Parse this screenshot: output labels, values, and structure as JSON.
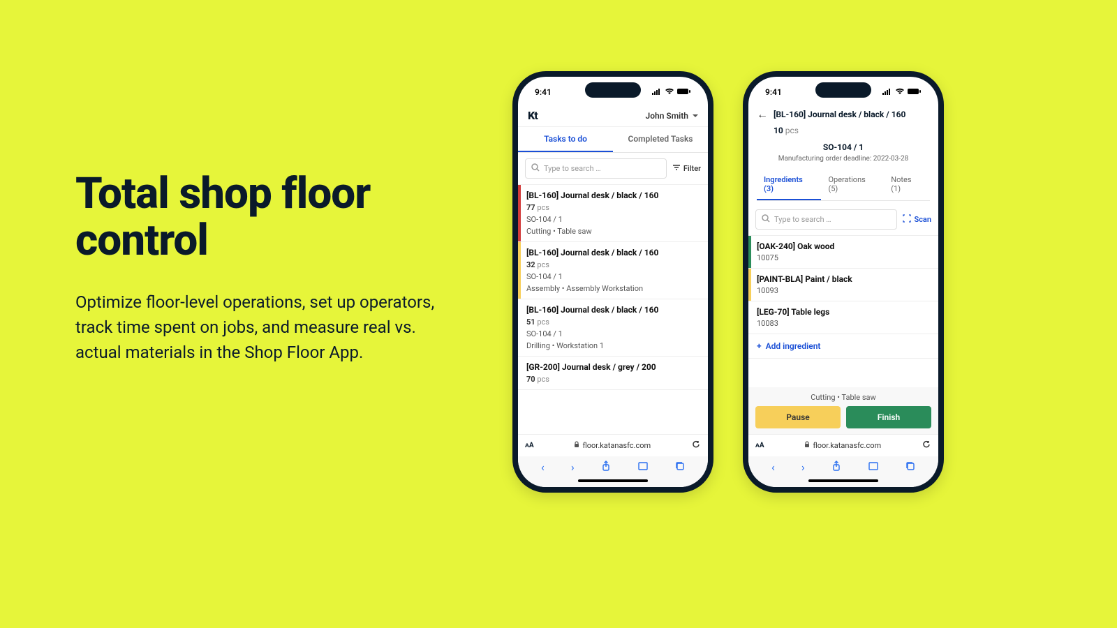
{
  "hero": {
    "title": "Total shop floor control",
    "body": "Optimize floor-level operations, set up operators, track time spent on jobs, and measure real vs. actual materials in the Shop Floor App."
  },
  "status_time": "9:41",
  "browser_url": "floor.katanasfc.com",
  "phone1": {
    "logo": "Kt",
    "user": "John Smith",
    "tabs": {
      "todo": "Tasks to do",
      "completed": "Completed Tasks"
    },
    "search_placeholder": "Type to search …",
    "filter_label": "Filter",
    "tasks": [
      {
        "title": "[BL-160] Journal desk / black / 160",
        "qty": "77",
        "unit": "pcs",
        "so": "SO-104 / 1",
        "op": "Cutting  •  Table saw",
        "stripe": "#d23c3c"
      },
      {
        "title": "[BL-160] Journal desk / black / 160",
        "qty": "32",
        "unit": "pcs",
        "so": "SO-104 / 1",
        "op": "Assembly  •  Assembly Workstation",
        "stripe": "#f7cf5a"
      },
      {
        "title": "[BL-160] Journal desk / black / 160",
        "qty": "51",
        "unit": "pcs",
        "so": "SO-104 / 1",
        "op": "Drilling  •  Workstation 1",
        "stripe": "#ffffff"
      },
      {
        "title": "[GR-200] Journal desk / grey / 200",
        "qty": "70",
        "unit": "pcs",
        "so": "",
        "op": "",
        "stripe": "#ffffff"
      }
    ]
  },
  "phone2": {
    "title": "[BL-160] Journal desk / black / 160",
    "qty": "10",
    "unit": "pcs",
    "so": "SO-104 / 1",
    "deadline": "Manufacturing order deadline: 2022-03-28",
    "subtabs": {
      "ingredients": "Ingredients (3)",
      "operations": "Operations (5)",
      "notes": "Notes (1)"
    },
    "search_placeholder": "Type to search …",
    "scan_label": "Scan",
    "ingredients": [
      {
        "name": "[OAK-240] Oak wood",
        "code": "10075",
        "stripe": "#2a8c5a"
      },
      {
        "name": "[PAINT-BLA] Paint / black",
        "code": "10093",
        "stripe": "#f7cf5a"
      },
      {
        "name": "[LEG-70] Table legs",
        "code": "10083",
        "stripe": "#ffffff"
      }
    ],
    "add_label": "Add ingredient",
    "op_row": "Cutting  •  Table saw",
    "pause_label": "Pause",
    "finish_label": "Finish"
  }
}
